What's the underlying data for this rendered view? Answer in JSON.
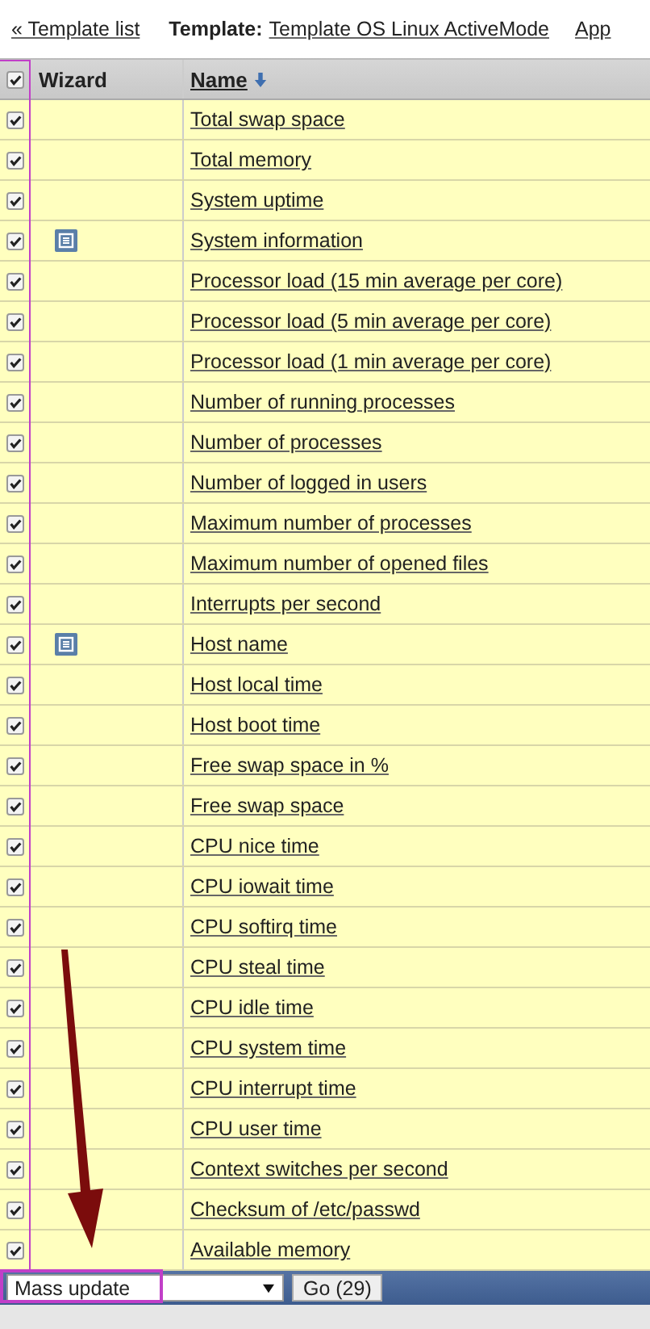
{
  "breadcrumb": {
    "back_link": "« Template list",
    "template_label": "Template:",
    "template_link": "Template OS Linux ActiveMode",
    "next_link": "App"
  },
  "table": {
    "header_checked": true,
    "columns": [
      "Wizard",
      "Name"
    ],
    "sort_desc": true,
    "rows": [
      {
        "checked": true,
        "wizard_icon": false,
        "name": "Total swap space"
      },
      {
        "checked": true,
        "wizard_icon": false,
        "name": "Total memory"
      },
      {
        "checked": true,
        "wizard_icon": false,
        "name": "System uptime"
      },
      {
        "checked": true,
        "wizard_icon": true,
        "name": "System information"
      },
      {
        "checked": true,
        "wizard_icon": false,
        "name": "Processor load (15 min average per core)"
      },
      {
        "checked": true,
        "wizard_icon": false,
        "name": "Processor load (5 min average per core)"
      },
      {
        "checked": true,
        "wizard_icon": false,
        "name": "Processor load (1 min average per core)"
      },
      {
        "checked": true,
        "wizard_icon": false,
        "name": "Number of running processes"
      },
      {
        "checked": true,
        "wizard_icon": false,
        "name": "Number of processes"
      },
      {
        "checked": true,
        "wizard_icon": false,
        "name": "Number of logged in users"
      },
      {
        "checked": true,
        "wizard_icon": false,
        "name": "Maximum number of processes"
      },
      {
        "checked": true,
        "wizard_icon": false,
        "name": "Maximum number of opened files"
      },
      {
        "checked": true,
        "wizard_icon": false,
        "name": "Interrupts per second"
      },
      {
        "checked": true,
        "wizard_icon": true,
        "name": "Host name"
      },
      {
        "checked": true,
        "wizard_icon": false,
        "name": "Host local time"
      },
      {
        "checked": true,
        "wizard_icon": false,
        "name": "Host boot time"
      },
      {
        "checked": true,
        "wizard_icon": false,
        "name": "Free swap space in %"
      },
      {
        "checked": true,
        "wizard_icon": false,
        "name": "Free swap space"
      },
      {
        "checked": true,
        "wizard_icon": false,
        "name": "CPU nice time"
      },
      {
        "checked": true,
        "wizard_icon": false,
        "name": "CPU iowait time"
      },
      {
        "checked": true,
        "wizard_icon": false,
        "name": "CPU softirq time"
      },
      {
        "checked": true,
        "wizard_icon": false,
        "name": "CPU steal time"
      },
      {
        "checked": true,
        "wizard_icon": false,
        "name": "CPU idle time"
      },
      {
        "checked": true,
        "wizard_icon": false,
        "name": "CPU system time"
      },
      {
        "checked": true,
        "wizard_icon": false,
        "name": "CPU interrupt time"
      },
      {
        "checked": true,
        "wizard_icon": false,
        "name": "CPU user time"
      },
      {
        "checked": true,
        "wizard_icon": false,
        "name": "Context switches per second"
      },
      {
        "checked": true,
        "wizard_icon": false,
        "name": "Checksum of /etc/passwd"
      },
      {
        "checked": true,
        "wizard_icon": false,
        "name": "Available memory"
      }
    ]
  },
  "footer": {
    "action_select": "Mass update",
    "go_button": "Go (29)"
  }
}
